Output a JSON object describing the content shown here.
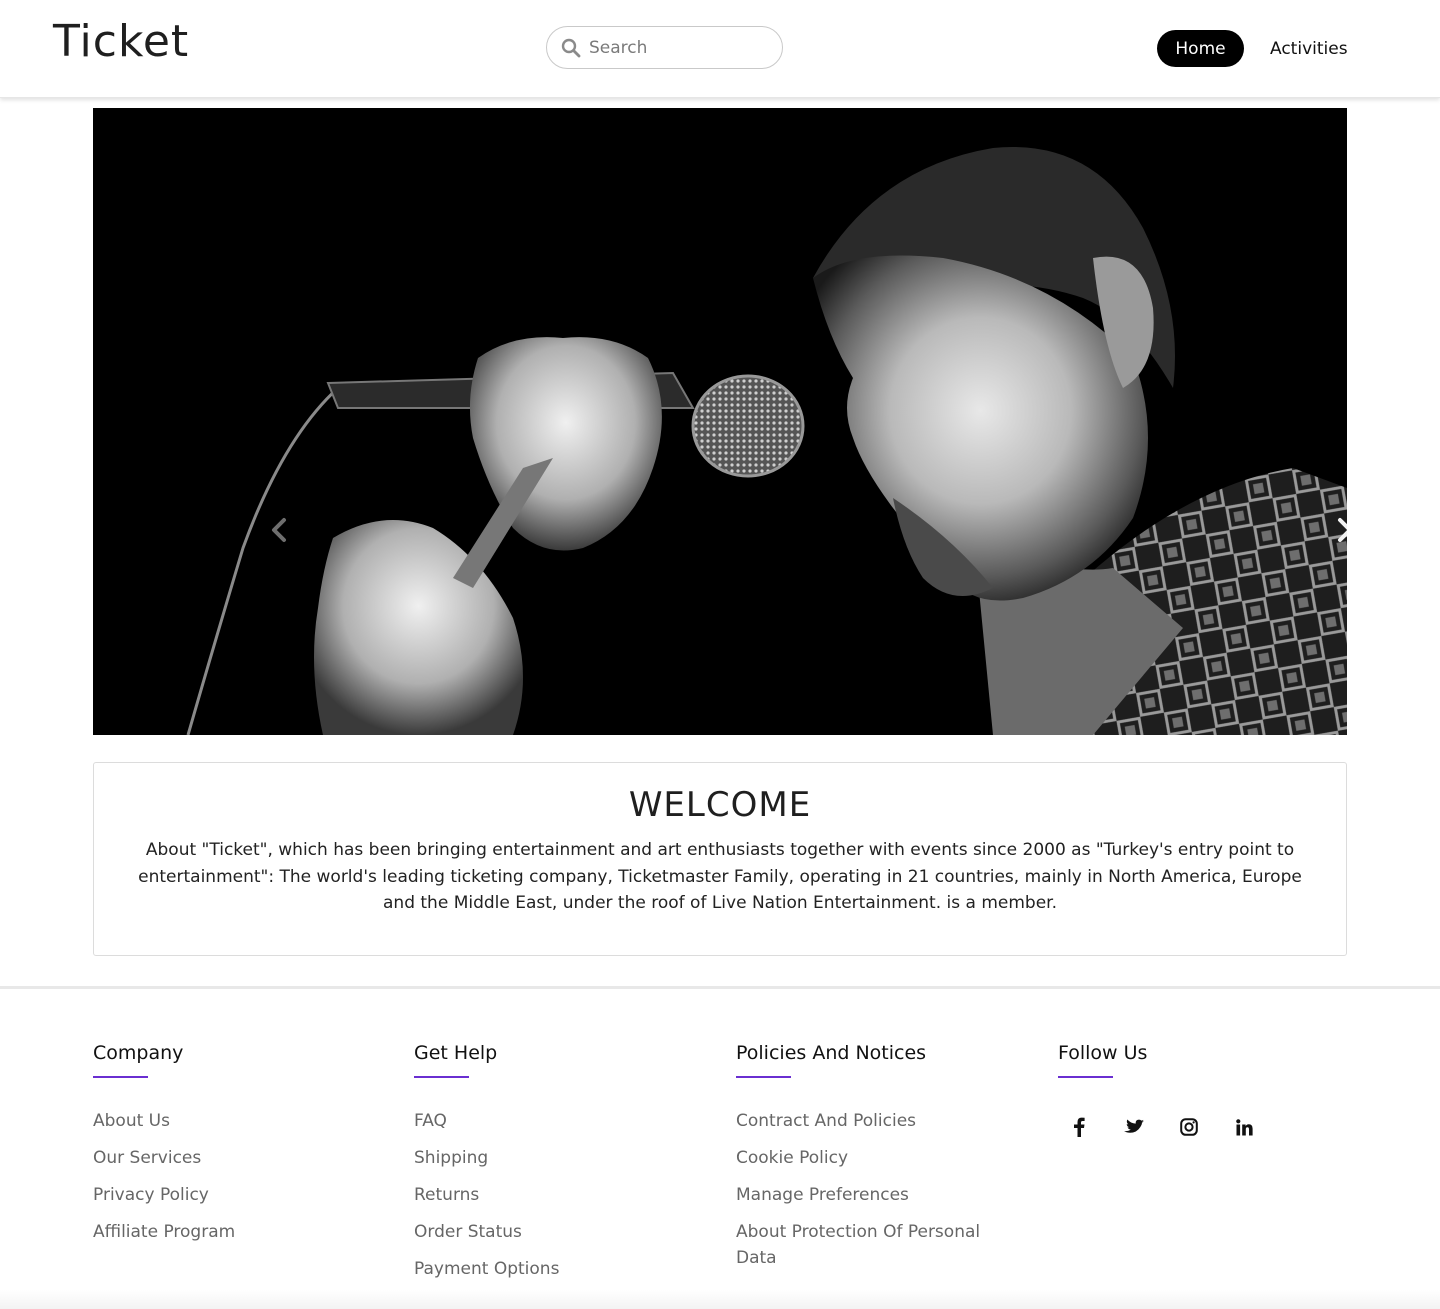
{
  "header": {
    "logo": "Ticket",
    "search_placeholder": "Search",
    "nav": {
      "home": "Home",
      "activities": "Activities"
    }
  },
  "hero": {
    "image": "black-and-white photo of a man singing into a microphone",
    "prev_icon": "chevron-left-icon",
    "next_icon": "chevron-right-icon"
  },
  "welcome": {
    "title": "WELCOME",
    "text": "About \"Ticket\", which has been bringing entertainment and art enthusiasts together with events since 2000 as \"Turkey's entry point to entertainment\": The world's leading ticketing company, Ticketmaster Family, operating in 21 countries, mainly in North America, Europe and the Middle East, under the roof of Live Nation Entertainment. is a member."
  },
  "footer": {
    "accent": "#6a2fd1",
    "company": {
      "title": "Company",
      "items": [
        "About Us",
        "Our Services",
        "Privacy Policy",
        "Affiliate Program"
      ]
    },
    "help": {
      "title": "Get Help",
      "items": [
        "FAQ",
        "Shipping",
        "Returns",
        "Order Status",
        "Payment Options"
      ]
    },
    "policies": {
      "title": "Policies And Notices",
      "items": [
        "Contract And Policies",
        "Cookie Policy",
        "Manage Preferences",
        "About Protection Of Personal Data"
      ]
    },
    "follow": {
      "title": "Follow Us",
      "icons": [
        "facebook-icon",
        "twitter-icon",
        "instagram-icon",
        "linkedin-icon"
      ]
    }
  }
}
